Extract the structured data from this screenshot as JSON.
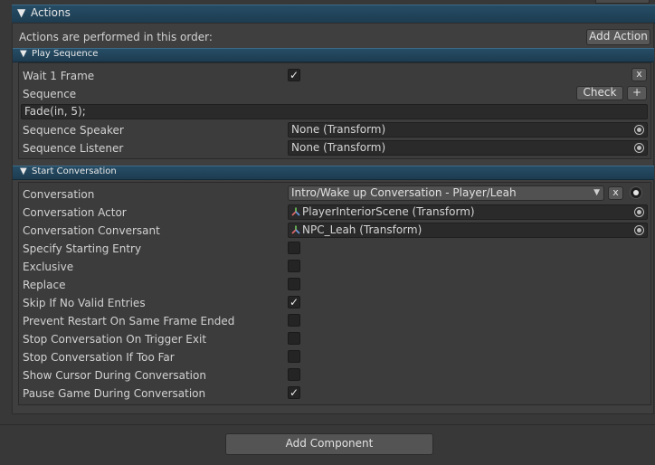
{
  "actions_header": {
    "title": "Actions"
  },
  "intro": {
    "text": "Actions are performed in this order:",
    "add_action": "Add Action"
  },
  "play_sequence": {
    "title": "Play Sequence",
    "close": "x",
    "wait_label": "Wait 1 Frame",
    "wait_checked": true,
    "sequence_label": "Sequence",
    "check": "Check",
    "plus": "+",
    "sequence_value": "Fade(in, 5);",
    "speaker_label": "Sequence Speaker",
    "speaker_value": "None (Transform)",
    "listener_label": "Sequence Listener",
    "listener_value": "None (Transform)"
  },
  "start_conversation": {
    "title": "Start Conversation",
    "conversation_label": "Conversation",
    "conversation_value": "Intro/Wake up Conversation - Player/Leah",
    "clear": "x",
    "actor_label": "Conversation Actor",
    "actor_value": "PlayerInteriorScene (Transform)",
    "conversant_label": "Conversation Conversant",
    "conversant_value": "NPC_Leah (Transform)",
    "options": [
      {
        "label": "Specify Starting Entry",
        "checked": false
      },
      {
        "label": "Exclusive",
        "checked": false
      },
      {
        "label": "Replace",
        "checked": false
      },
      {
        "label": "Skip If No Valid Entries",
        "checked": true
      },
      {
        "label": "Prevent Restart On Same Frame Ended",
        "checked": false
      },
      {
        "label": "Stop Conversation On Trigger Exit",
        "checked": false
      },
      {
        "label": "Stop Conversation If Too Far",
        "checked": false
      },
      {
        "label": "Show Cursor During Conversation",
        "checked": false
      },
      {
        "label": "Pause Game During Conversation",
        "checked": true
      }
    ]
  },
  "footer": {
    "add_component": "Add Component"
  },
  "glyphs": {
    "triangle": "▼",
    "check": "✓",
    "dropdown": "▼"
  },
  "icons": [
    "transform-icon",
    "object-picker-icon",
    "dropdown-arrow-icon",
    "foldout-triangle-icon"
  ]
}
